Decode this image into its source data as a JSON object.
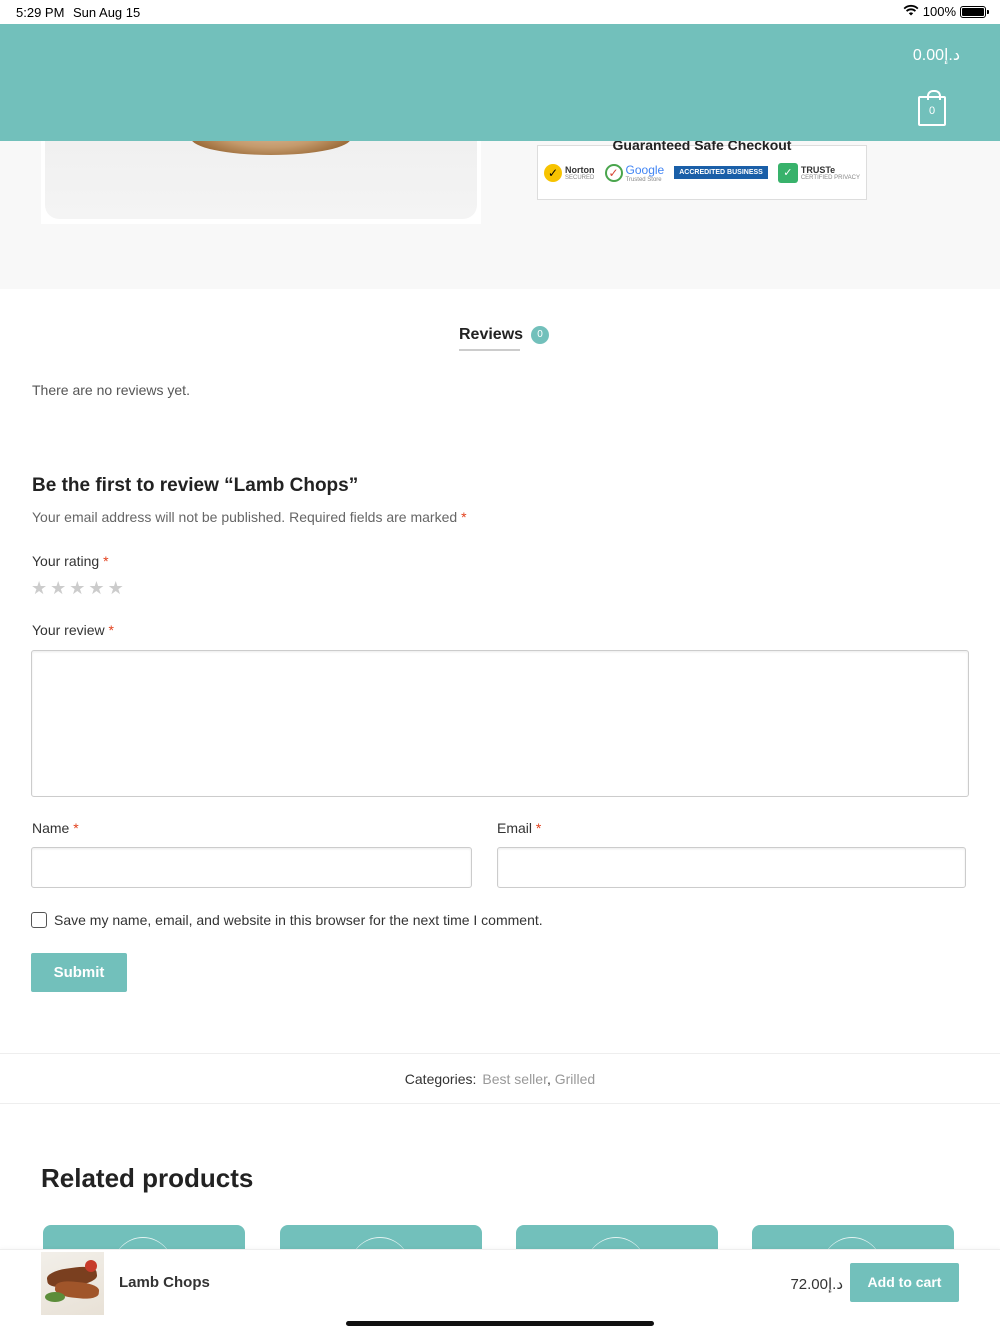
{
  "status_bar": {
    "time": "5:29 PM",
    "date": "Sun Aug 15",
    "battery": "100%",
    "battery_level": 1.0
  },
  "header": {
    "cart_total": "0.00د.إ",
    "cart_count": "0",
    "background_color": "#72c0bb"
  },
  "product": {
    "checkout_title": "Guaranteed Safe Checkout",
    "badges": {
      "norton": "Norton",
      "norton_sub": "SECURED",
      "google": "Google",
      "google_sub": "Trusted Store",
      "bbb": "ACCREDITED BUSINESS",
      "truste": "TRUSTe",
      "truste_sub": "CERTIFIED PRIVACY"
    }
  },
  "tabs": {
    "reviews_label": "Reviews",
    "reviews_count": "0"
  },
  "reviews": {
    "empty_message": "There are no reviews yet.",
    "form_heading": "Be the first to review “Lamb Chops”",
    "email_note": "Your email address will not be published. Required fields are marked",
    "required_mark": "*",
    "rating_label": "Your rating",
    "rating_value": 0,
    "rating_max": 5,
    "review_label": "Your review",
    "review_value": "",
    "name_label": "Name",
    "name_value": "",
    "email_label": "Email",
    "email_value": "",
    "save_info_label": "Save my name, email, and website in this browser for the next time I comment.",
    "save_info_checked": false,
    "submit_label": "Submit"
  },
  "categories": {
    "label": "Categories:",
    "items": [
      "Best seller",
      "Grilled"
    ],
    "separator": ","
  },
  "related": {
    "title": "Related products"
  },
  "sticky_bar": {
    "product_name": "Lamb Chops",
    "price": "72.00د.إ",
    "add_to_cart_label": "Add to cart"
  },
  "colors": {
    "accent": "#72c0bb",
    "required": "#e2401c"
  }
}
